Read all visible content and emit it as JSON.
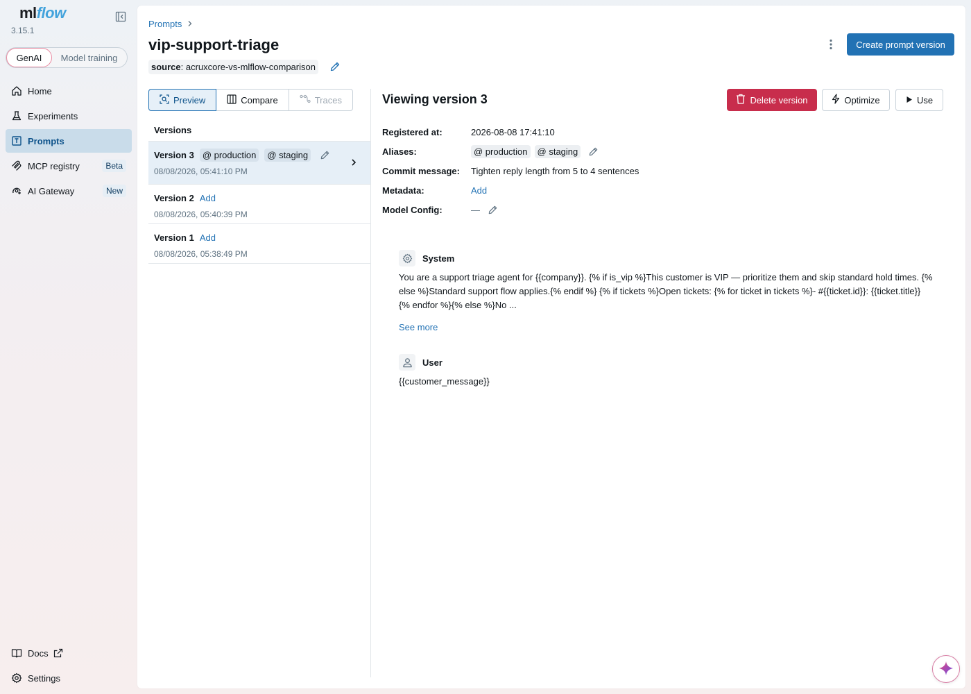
{
  "app": {
    "logo_ml": "ml",
    "logo_flow": "flow",
    "version": "3.15.1"
  },
  "mode_switch": {
    "genai": "GenAI",
    "training": "Model training"
  },
  "sidebar": {
    "items": [
      {
        "label": "Home",
        "icon": "home-icon"
      },
      {
        "label": "Experiments",
        "icon": "flask-icon"
      },
      {
        "label": "Prompts",
        "icon": "prompt-icon"
      },
      {
        "label": "MCP registry",
        "icon": "mcp-icon",
        "tag": "Beta"
      },
      {
        "label": "AI Gateway",
        "icon": "gateway-icon",
        "tag": "New"
      }
    ],
    "bottom": [
      {
        "label": "Docs",
        "icon": "book-icon"
      },
      {
        "label": "Settings",
        "icon": "gear-icon"
      }
    ]
  },
  "header": {
    "breadcrumb": "Prompts",
    "title": "vip-support-triage",
    "create_button": "Create prompt version",
    "source_key": "source",
    "source_value": ": acruxcore-vs-mlflow-comparison"
  },
  "view_tabs": {
    "preview": "Preview",
    "compare": "Compare",
    "traces": "Traces"
  },
  "versions": {
    "heading": "Versions",
    "add_label": "Add",
    "items": [
      {
        "name": "Version 3",
        "aliases": [
          "@ production",
          "@ staging"
        ],
        "date": "08/08/2026, 05:41:10 PM"
      },
      {
        "name": "Version 2",
        "date": "08/08/2026, 05:40:39 PM"
      },
      {
        "name": "Version 1",
        "date": "08/08/2026, 05:38:49 PM"
      }
    ]
  },
  "detail": {
    "title": "Viewing version 3",
    "delete_button": "Delete version",
    "optimize_button": "Optimize",
    "use_button": "Use",
    "registered_label": "Registered at:",
    "registered_value": "2026-08-08 17:41:10",
    "aliases_label": "Aliases:",
    "aliases": [
      "@ production",
      "@ staging"
    ],
    "commit_label": "Commit message:",
    "commit_value": "Tighten reply length from 5 to 4 sentences",
    "metadata_label": "Metadata:",
    "metadata_add": "Add",
    "model_config_label": "Model Config:",
    "model_config_value": "—"
  },
  "messages": {
    "system_role": "System",
    "system_text": "You are a support triage agent for {{company}}. {% if is_vip %}This customer is VIP — prioritize them and skip standard hold times. {% else %}Standard support flow applies.{% endif %} {% if tickets %}Open tickets: {% for ticket in tickets %}- #{{ticket.id}}: {{ticket.title}} {% endfor %}{% else %}No ...",
    "see_more": "See more",
    "user_role": "User",
    "user_text": "{{customer_message}}"
  },
  "colors": {
    "primary": "#2272b4",
    "danger": "#c82d4c",
    "active_nav_bg": "#c9dcea",
    "selected_row_bg": "#e6eff7"
  }
}
